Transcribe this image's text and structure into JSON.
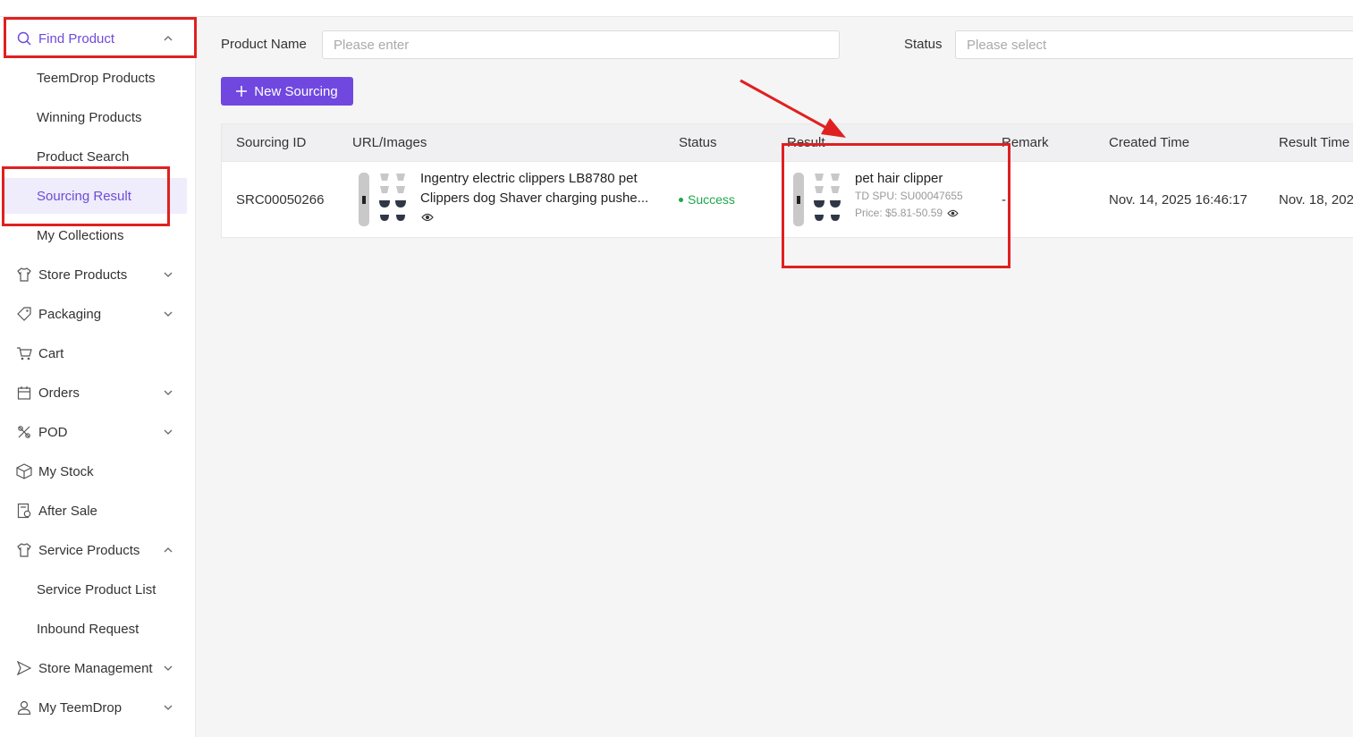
{
  "sidebar": {
    "find_product": "Find Product",
    "sub_find": [
      "TeemDrop Products",
      "Winning Products",
      "Product Search",
      "Sourcing Result",
      "My Collections"
    ],
    "store_products": "Store Products",
    "packaging": "Packaging",
    "cart": "Cart",
    "orders": "Orders",
    "pod": "POD",
    "my_stock": "My Stock",
    "after_sale": "After Sale",
    "service_products": "Service Products",
    "sub_service": [
      "Service Product List",
      "Inbound Request"
    ],
    "store_management": "Store Management",
    "my_teemdrop": "My TeemDrop"
  },
  "filters": {
    "product_name_label": "Product Name",
    "product_name_placeholder": "Please enter",
    "status_label": "Status",
    "status_placeholder": "Please select"
  },
  "toolbar": {
    "new_sourcing": "New Sourcing"
  },
  "table": {
    "headers": [
      "Sourcing ID",
      "URL/Images",
      "Status",
      "Result",
      "Remark",
      "Created Time",
      "Result Time"
    ],
    "rows": [
      {
        "sourcing_id": "SRC00050266",
        "title": "Ingentry electric clippers LB8780 pet Clippers dog Shaver charging pushe...",
        "status": "Success",
        "result_name": "pet hair clipper",
        "result_spu": "TD SPU: SU00047655",
        "result_price": "Price: $5.81-50.59",
        "remark": "-",
        "created_time": "Nov. 14, 2025 16:46:17",
        "result_time": "Nov. 18, 202"
      }
    ]
  },
  "colors": {
    "accent": "#7048e0",
    "success": "#1fa74a",
    "annotation": "#e02020"
  }
}
